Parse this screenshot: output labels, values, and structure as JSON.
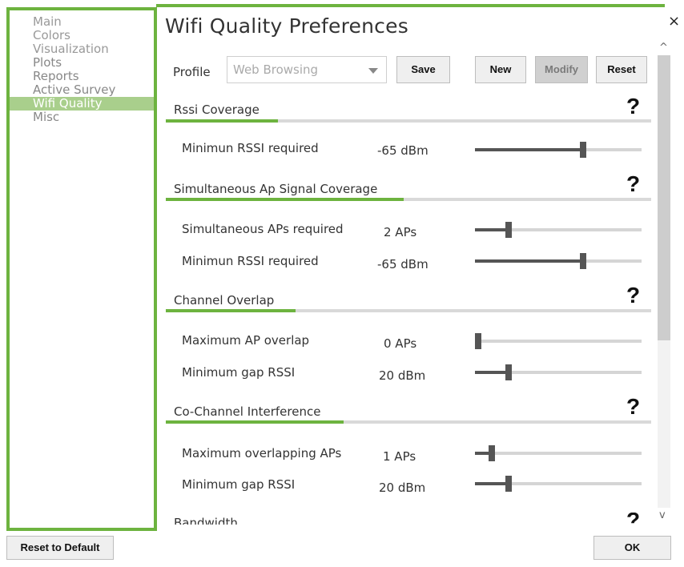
{
  "window": {
    "title": "Wifi Quality Preferences",
    "close_glyph": "×"
  },
  "sidebar": {
    "items": [
      {
        "label": "Main"
      },
      {
        "label": "Colors"
      },
      {
        "label": "Visualization"
      },
      {
        "label": "Plots"
      },
      {
        "label": "Reports"
      },
      {
        "label": "Active Survey"
      },
      {
        "label": "Wifi Quality",
        "active": true
      },
      {
        "label": "Misc"
      }
    ]
  },
  "profile": {
    "label": "Profile",
    "selected": "Web Browsing",
    "save_label": "Save",
    "new_label": "New",
    "modify_label": "Modify",
    "reset_label": "Reset"
  },
  "sections": [
    {
      "title": "Rssi Coverage",
      "help": "?",
      "rows": [
        {
          "label": "Minimun RSSI required",
          "value": "-65 dBm",
          "level": 0.65
        }
      ]
    },
    {
      "title": "Simultaneous Ap Signal Coverage",
      "help": "?",
      "rows": [
        {
          "label": "Simultaneous APs required",
          "value": "2 APs",
          "level": 0.2
        },
        {
          "label": "Minimun RSSI required",
          "value": "-65 dBm",
          "level": 0.65
        }
      ]
    },
    {
      "title": "Channel Overlap",
      "help": "?",
      "rows": [
        {
          "label": "Maximum AP overlap",
          "value": "0 APs",
          "level": 0.0
        },
        {
          "label": "Minimum gap RSSI",
          "value": "20 dBm",
          "level": 0.2
        }
      ]
    },
    {
      "title": "Co-Channel Interference",
      "help": "?",
      "rows": [
        {
          "label": "Maximum overlapping APs",
          "value": "1 APs",
          "level": 0.1
        },
        {
          "label": "Minimum gap RSSI",
          "value": "20 dBm",
          "level": 0.2
        }
      ]
    },
    {
      "title": "Bandwidth",
      "help": "?",
      "rows": []
    }
  ],
  "footer": {
    "reset_default_label": "Reset to Default",
    "ok_label": "OK"
  },
  "colors": {
    "accent": "#6db33f",
    "sidebar_active": "#a9cf8c",
    "slider": "#555555"
  },
  "icons": {
    "scroll_up": "^",
    "scroll_down": "v"
  }
}
